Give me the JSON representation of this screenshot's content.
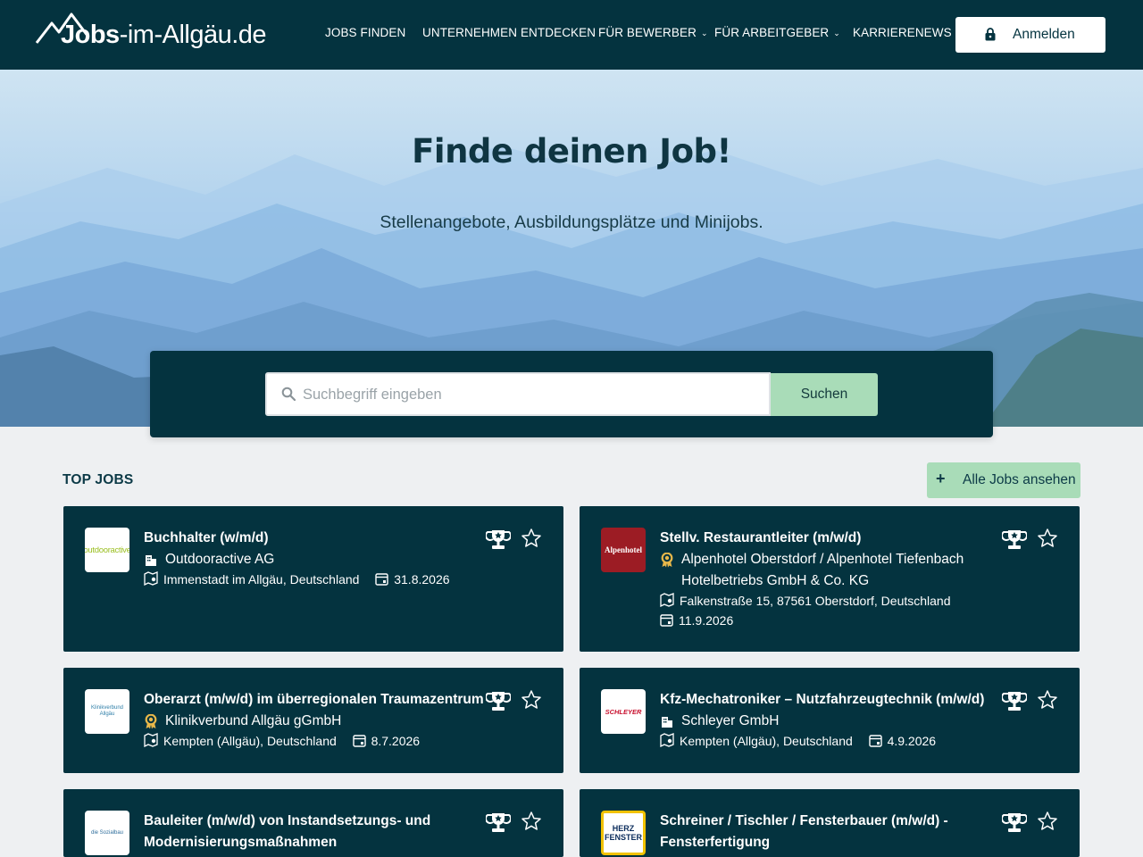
{
  "header": {
    "logo": {
      "bold": "Jobs",
      "rest": "-im-Allgäu.de"
    },
    "nav": [
      {
        "label": "JOBS FINDEN",
        "dropdown": false
      },
      {
        "label": "UNTERNEHMEN ENTDECKEN",
        "dropdown": false
      },
      {
        "label": "FÜR BEWERBER",
        "dropdown": true
      },
      {
        "label": "FÜR ARBEITGEBER",
        "dropdown": true
      },
      {
        "label": "KARRIERENEWS",
        "dropdown": false
      }
    ],
    "login_label": "Anmelden"
  },
  "hero": {
    "title": "Finde deinen Job!",
    "subtitle": "Stellenangebote, Ausbildungsplätze und Minijobs."
  },
  "search": {
    "placeholder": "Suchbegriff eingeben",
    "button_label": "Suchen"
  },
  "top_jobs": {
    "heading": "TOP JOBS",
    "all_jobs_label": "Alle Jobs ansehen",
    "jobs": [
      {
        "title": "Buchhalter (w/m/d)",
        "company": "Outdooractive AG",
        "company_icon": "building-icon",
        "location": "Immenstadt im Allgäu, Deutschland",
        "date": "31.8.2026",
        "logo_text": "outdooractive"
      },
      {
        "title": "Stellv. Restaurantleiter (m/w/d)",
        "company": "Alpenhotel Oberstdorf / Alpenhotel Tiefenbach Hotelbetriebs GmbH & Co. KG",
        "company_icon": "award-badge-icon",
        "location": "Falkenstraße 15, 87561 Oberstdorf, Deutschland",
        "date": "11.9.2026",
        "logo_text": "Alpenhotel"
      },
      {
        "title": "Oberarzt (m/w/d) im überregionalen Traumazentrum",
        "company": "Klinikverbund Allgäu gGmbH",
        "company_icon": "award-badge-icon",
        "location": "Kempten (Allgäu), Deutschland",
        "date": "8.7.2026",
        "logo_text": "Klinikverbund Allgäu"
      },
      {
        "title": "Kfz-Mechatroniker – Nutzfahrzeugtechnik (m/w/d)",
        "company": "Schleyer GmbH",
        "company_icon": "building-icon",
        "location": "Kempten (Allgäu), Deutschland",
        "date": "4.9.2026",
        "logo_text": "SCHLEYER"
      },
      {
        "title": "Bauleiter (m/w/d) von Instandsetzungs- und Modernisierungsmaßnahmen",
        "logo_text": "die Sozialbau"
      },
      {
        "title": "Schreiner / Tischler / Fensterbauer (m/w/d) - Fensterfertigung",
        "logo_text": "HERZ FENSTER"
      }
    ]
  },
  "colors": {
    "header_bg": "#04333f",
    "accent_green": "#a9dcb8",
    "card_bg": "#04333f",
    "page_bg": "#eef0f2",
    "award_gold": "#e8b84a"
  }
}
